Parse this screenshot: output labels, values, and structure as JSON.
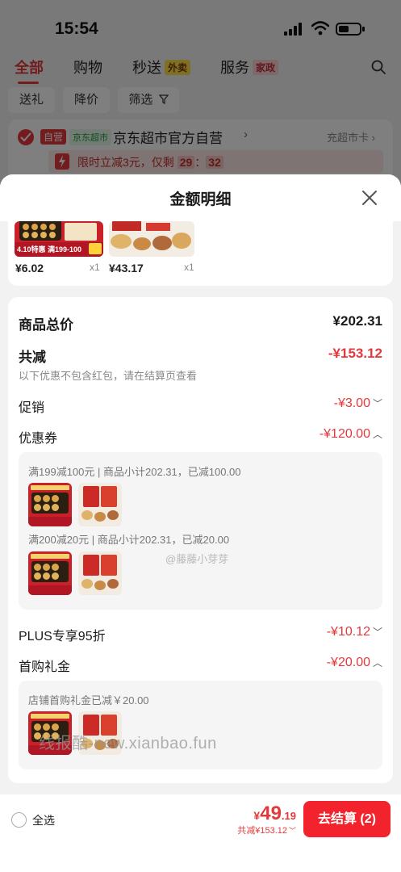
{
  "status_bar": {
    "time": "15:54"
  },
  "top_tabs": [
    {
      "label": "全部",
      "active": true
    },
    {
      "label": "购物",
      "active": false
    },
    {
      "label": "秒送",
      "tag": "外卖"
    },
    {
      "label": "服务",
      "tag": "家政"
    }
  ],
  "filter_chips": [
    "送礼",
    "降价",
    "筛选"
  ],
  "store": {
    "self_badge": "自营",
    "jd_badge": "京东超市",
    "name": "京东超市官方自营",
    "arrow": "›",
    "card_link": "充超市卡 ›",
    "promo_prefix": "限时立减3元，仅剩",
    "countdown_h": "29",
    "countdown_sep": "：",
    "countdown_m": "32"
  },
  "sheet": {
    "title": "金额明细",
    "products": [
      {
        "price": "¥6.02",
        "qty": "x1"
      },
      {
        "price": "¥43.17",
        "qty": "x1"
      }
    ],
    "product_tag": "4.10特惠 满199-100"
  },
  "details": {
    "total_label": "商品总价",
    "total_value": "¥202.31",
    "reduce_label": "共减",
    "reduce_value": "-¥153.12",
    "reduce_note": "以下优惠不包含红包，请在结算页查看",
    "promo_label": "促销",
    "promo_value": "-¥3.00",
    "coupon_label": "优惠券",
    "coupon_value": "-¥120.00",
    "coupon_lines": [
      "满199减100元 | 商品小计202.31，已减100.00",
      "满200减20元 | 商品小计202.31，已减20.00"
    ],
    "plus_label": "PLUS专享95折",
    "plus_value": "-¥10.12",
    "gift_label": "首购礼金",
    "gift_value": "-¥20.00",
    "gift_line": "店铺首购礼金已减￥20.00"
  },
  "watermarks": {
    "weibo": "@藤藤小芽芽",
    "site": "线报酷-new.xianbao.fun"
  },
  "bottom": {
    "select_all": "全选",
    "currency": "¥",
    "total_int": "49",
    "total_dec": ".19",
    "saved": "共减¥153.12",
    "checkout": "去结算 (2)"
  },
  "colors": {
    "accent": "#e4393c",
    "checkout": "#f2232c"
  },
  "icons": [
    "search-icon",
    "close-icon",
    "check-icon",
    "bolt-icon",
    "chevron-down-icon",
    "chevron-up-icon",
    "filter-icon",
    "wifi-icon",
    "battery-icon",
    "signal-icon"
  ]
}
